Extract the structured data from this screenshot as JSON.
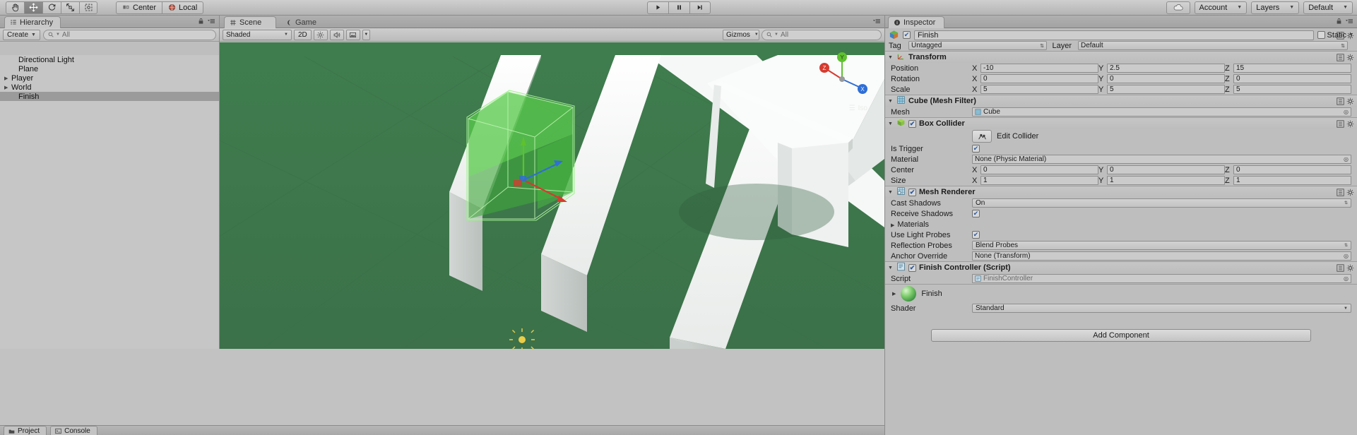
{
  "toolbar": {
    "tools": [
      {
        "name": "hand-tool",
        "glyph": "hand",
        "active": false
      },
      {
        "name": "move-tool",
        "glyph": "move",
        "active": true
      },
      {
        "name": "rotate-tool",
        "glyph": "rotate",
        "active": false
      },
      {
        "name": "scale-tool",
        "glyph": "scale",
        "active": false
      },
      {
        "name": "rect-tool",
        "glyph": "rect",
        "active": false
      }
    ],
    "pivot_label": "Center",
    "space_label": "Local",
    "play_label": "play-button",
    "pause_label": "pause-button",
    "step_label": "step-button",
    "cloud_label": "cloud-button",
    "account_label": "Account",
    "layers_label": "Layers",
    "layout_label": "Default"
  },
  "hierarchy": {
    "tab": "Hierarchy",
    "create_label": "Create",
    "search_placeholder": "All",
    "items": [
      {
        "label": "Directional Light",
        "indent": 1,
        "expandable": false,
        "selected": false
      },
      {
        "label": "Plane",
        "indent": 1,
        "expandable": false,
        "selected": false
      },
      {
        "label": "Player",
        "indent": 0,
        "expandable": true,
        "selected": false
      },
      {
        "label": "World",
        "indent": 0,
        "expandable": true,
        "selected": false
      },
      {
        "label": "Finish",
        "indent": 1,
        "expandable": false,
        "selected": true
      }
    ]
  },
  "scene": {
    "tab_scene": "Scene",
    "tab_game": "Game",
    "shading_mode": "Shaded",
    "twod_label": "2D",
    "lighting_icon": "sun-icon",
    "audio_icon": "speaker-icon",
    "fx_icon": "image-icon",
    "gizmos_label": "Gizmos",
    "search_placeholder": "All",
    "axis_labels": [
      "X",
      "Y",
      "Z"
    ],
    "persp_label": "Iso"
  },
  "inspector": {
    "tab": "Inspector",
    "object_name": "Finish",
    "static_label": "Static",
    "tag_label": "Tag",
    "tag_value": "Untagged",
    "layer_label": "Layer",
    "layer_value": "Default",
    "components": [
      {
        "name": "Transform",
        "has_checkbox": false,
        "rows": [
          {
            "label": "Position",
            "type": "vec3",
            "values": [
              "-10",
              "2.5",
              "15"
            ]
          },
          {
            "label": "Rotation",
            "type": "vec3",
            "values": [
              "0",
              "0",
              "0"
            ]
          },
          {
            "label": "Scale",
            "type": "vec3",
            "values": [
              "5",
              "5",
              "5"
            ]
          }
        ]
      },
      {
        "name": "Cube (Mesh Filter)",
        "has_checkbox": false,
        "rows": [
          {
            "label": "Mesh",
            "type": "object",
            "value": "Cube"
          }
        ]
      },
      {
        "name": "Box Collider",
        "has_checkbox": true,
        "checked": true,
        "edit_collider_label": "Edit Collider",
        "rows": [
          {
            "label": "Is Trigger",
            "type": "check",
            "checked": true
          },
          {
            "label": "Material",
            "type": "object",
            "value": "None (Physic Material)"
          },
          {
            "label": "Center",
            "type": "vec3",
            "values": [
              "0",
              "0",
              "0"
            ]
          },
          {
            "label": "Size",
            "type": "vec3",
            "values": [
              "1",
              "1",
              "1"
            ]
          }
        ]
      },
      {
        "name": "Mesh Renderer",
        "has_checkbox": true,
        "checked": true,
        "rows": [
          {
            "label": "Cast Shadows",
            "type": "dropdown",
            "value": "On"
          },
          {
            "label": "Receive Shadows",
            "type": "check",
            "checked": true
          },
          {
            "label": "Materials",
            "type": "foldout"
          },
          {
            "label": "Use Light Probes",
            "type": "check",
            "checked": true
          },
          {
            "label": "Reflection Probes",
            "type": "dropdown",
            "value": "Blend Probes"
          },
          {
            "label": "Anchor Override",
            "type": "object",
            "value": "None (Transform)"
          }
        ]
      },
      {
        "name": "Finish Controller (Script)",
        "has_checkbox": true,
        "checked": true,
        "rows": [
          {
            "label": "Script",
            "type": "object",
            "value": "FinishController"
          }
        ]
      }
    ],
    "material": {
      "name": "Finish",
      "shader_label": "Shader",
      "shader_value": "Standard"
    },
    "add_component_label": "Add Component"
  },
  "bottom": {
    "tabs": [
      "Project",
      "Console"
    ]
  },
  "colors": {
    "ground": "#3f7a4d",
    "wall": "#f2f2f2",
    "trigger_green": "#54c44a",
    "axis_x": "#d63b2f",
    "axis_y": "#5ec12e",
    "axis_z": "#2f6fd6",
    "panel_bg": "#bebebe"
  }
}
